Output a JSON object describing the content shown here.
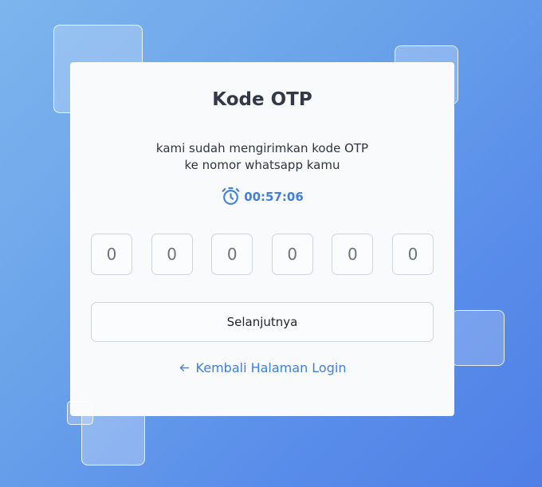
{
  "card": {
    "title": "Kode OTP",
    "description_line1": "kami sudah mengirimkan kode OTP",
    "description_line2": "ke nomor whatsapp kamu",
    "timer": {
      "icon": "stopwatch-icon",
      "value": "00:57:06"
    },
    "otp_digits": [
      "0",
      "0",
      "0",
      "0",
      "0",
      "0"
    ],
    "next_button_label": "Selanjutnya",
    "back_link": {
      "icon": "arrow-left-icon",
      "label": "Kembali Halaman Login"
    }
  },
  "colors": {
    "accent": "#3f7fe0",
    "title": "#323a49",
    "card_bg": "#f8fafc",
    "input_border": "#cfd5dd",
    "background_start": "#7db5ee",
    "background_end": "#4f7fe6"
  }
}
